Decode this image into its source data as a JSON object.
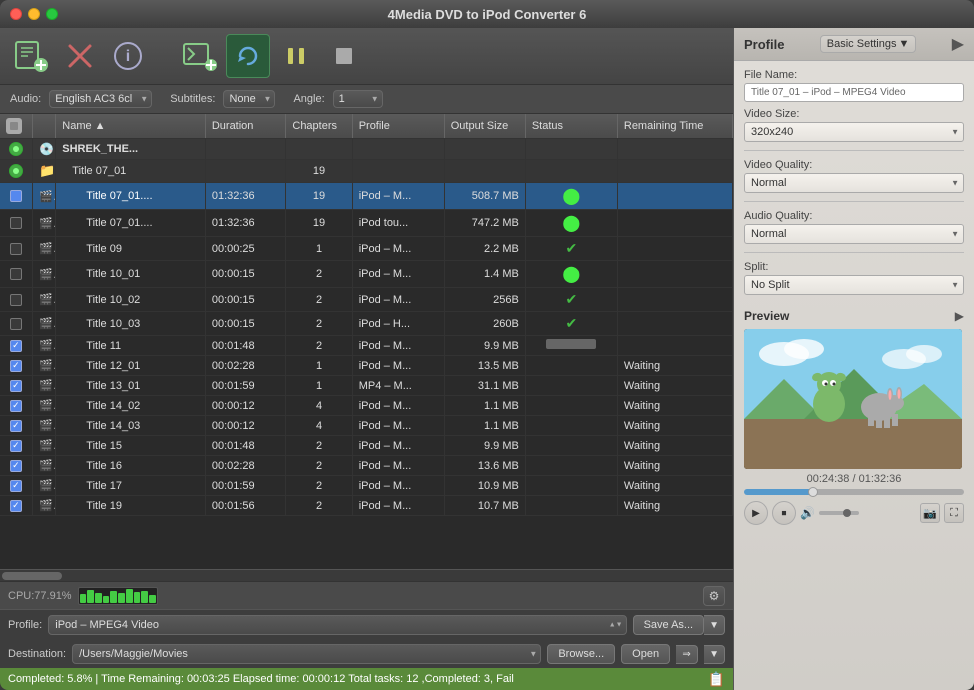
{
  "window": {
    "title": "4Media DVD to iPod Converter 6"
  },
  "toolbar": {
    "buttons": [
      {
        "id": "add",
        "label": "Add",
        "icon": "🎬+"
      },
      {
        "id": "delete",
        "label": "Delete",
        "icon": "✕"
      },
      {
        "id": "info",
        "label": "Info",
        "icon": "ℹ"
      },
      {
        "id": "add2",
        "label": "Add2",
        "icon": "📺+"
      },
      {
        "id": "refresh",
        "label": "Refresh/Convert",
        "icon": "↻"
      },
      {
        "id": "pause",
        "label": "Pause",
        "icon": "⏸"
      },
      {
        "id": "stop",
        "label": "Stop",
        "icon": "⏹"
      }
    ]
  },
  "controls": {
    "audio_label": "Audio:",
    "audio_value": "English AC3 6cl",
    "subtitles_label": "Subtitles:",
    "subtitles_value": "None",
    "angle_label": "Angle:",
    "angle_value": "1"
  },
  "table": {
    "headers": [
      "",
      "",
      "Name",
      "Duration",
      "Chapters",
      "Profile",
      "Output Size",
      "Status",
      "Remaining Time"
    ],
    "rows": [
      {
        "level": 0,
        "checked": null,
        "icon": "disc",
        "name": "SHREK_THE...",
        "duration": "",
        "chapters": "",
        "profile": "",
        "size": "",
        "status": "",
        "remaining": "",
        "row_type": "disc"
      },
      {
        "level": 1,
        "checked": null,
        "icon": "folder",
        "name": "Title 07_01",
        "duration": "",
        "chapters": "19",
        "profile": "",
        "size": "",
        "status": "",
        "remaining": "",
        "row_type": "folder"
      },
      {
        "level": 2,
        "checked": true,
        "icon": "movie",
        "name": "Title 07_01....",
        "duration": "01:32:36",
        "chapters": "19",
        "profile": "iPod – M...",
        "size": "508.7 MB",
        "status": "green_circle",
        "remaining": "",
        "row_type": "item",
        "selected": true
      },
      {
        "level": 2,
        "checked": false,
        "icon": "movie",
        "name": "Title 07_01....",
        "duration": "01:32:36",
        "chapters": "19",
        "profile": "iPod tou...",
        "size": "747.2 MB",
        "status": "green_circle",
        "remaining": "",
        "row_type": "item"
      },
      {
        "level": 2,
        "checked": false,
        "icon": "movie",
        "name": "Title 09",
        "duration": "00:00:25",
        "chapters": "1",
        "profile": "iPod – M...",
        "size": "2.2 MB",
        "status": "check_green",
        "remaining": "",
        "row_type": "item"
      },
      {
        "level": 2,
        "checked": false,
        "icon": "movie",
        "name": "Title 10_01",
        "duration": "00:00:15",
        "chapters": "2",
        "profile": "iPod – M...",
        "size": "1.4 MB",
        "status": "green_circle",
        "remaining": "",
        "row_type": "item"
      },
      {
        "level": 2,
        "checked": false,
        "icon": "movie",
        "name": "Title 10_02",
        "duration": "00:00:15",
        "chapters": "2",
        "profile": "iPod – M...",
        "size": "256B",
        "status": "check_green",
        "remaining": "",
        "row_type": "item"
      },
      {
        "level": 2,
        "checked": false,
        "icon": "movie",
        "name": "Title 10_03",
        "duration": "00:00:15",
        "chapters": "2",
        "profile": "iPod – H...",
        "size": "260B",
        "status": "check_green",
        "remaining": "",
        "row_type": "item"
      },
      {
        "level": 2,
        "checked": true,
        "icon": "movie",
        "name": "Title 11",
        "duration": "00:01:48",
        "chapters": "2",
        "profile": "iPod – M...",
        "size": "9.9 MB",
        "status": "progress",
        "remaining": "",
        "row_type": "item"
      },
      {
        "level": 2,
        "checked": true,
        "icon": "movie",
        "name": "Title 12_01",
        "duration": "00:02:28",
        "chapters": "1",
        "profile": "iPod – M...",
        "size": "13.5 MB",
        "status": "text",
        "remaining": "Waiting",
        "row_type": "item"
      },
      {
        "level": 2,
        "checked": true,
        "icon": "movie",
        "name": "Title 13_01",
        "duration": "00:01:59",
        "chapters": "1",
        "profile": "MP4 – M...",
        "size": "31.1 MB",
        "status": "text",
        "remaining": "Waiting",
        "row_type": "item"
      },
      {
        "level": 2,
        "checked": true,
        "icon": "movie",
        "name": "Title 14_02",
        "duration": "00:00:12",
        "chapters": "4",
        "profile": "iPod – M...",
        "size": "1.1 MB",
        "status": "text",
        "remaining": "Waiting",
        "row_type": "item"
      },
      {
        "level": 2,
        "checked": true,
        "icon": "movie",
        "name": "Title 14_03",
        "duration": "00:00:12",
        "chapters": "4",
        "profile": "iPod – M...",
        "size": "1.1 MB",
        "status": "text",
        "remaining": "Waiting",
        "row_type": "item"
      },
      {
        "level": 2,
        "checked": true,
        "icon": "movie",
        "name": "Title 15",
        "duration": "00:01:48",
        "chapters": "2",
        "profile": "iPod – M...",
        "size": "9.9 MB",
        "status": "text",
        "remaining": "Waiting",
        "row_type": "item"
      },
      {
        "level": 2,
        "checked": true,
        "icon": "movie",
        "name": "Title 16",
        "duration": "00:02:28",
        "chapters": "2",
        "profile": "iPod – M...",
        "size": "13.6 MB",
        "status": "text",
        "remaining": "Waiting",
        "row_type": "item"
      },
      {
        "level": 2,
        "checked": true,
        "icon": "movie",
        "name": "Title 17",
        "duration": "00:01:59",
        "chapters": "2",
        "profile": "iPod – M...",
        "size": "10.9 MB",
        "status": "text",
        "remaining": "Waiting",
        "row_type": "item"
      },
      {
        "level": 2,
        "checked": true,
        "icon": "movie",
        "name": "Title 19",
        "duration": "00:01:56",
        "chapters": "2",
        "profile": "iPod – M...",
        "size": "10.7 MB",
        "status": "text",
        "remaining": "Waiting",
        "row_type": "item"
      }
    ]
  },
  "cpu": {
    "label": "CPU:77.91%"
  },
  "profile_bar": {
    "label": "Profile:",
    "value": "iPod – MPEG4 Video",
    "save_as": "Save As..."
  },
  "destination_bar": {
    "label": "Destination:",
    "value": "/Users/Maggie/Movies",
    "browse_label": "Browse...",
    "open_label": "Open"
  },
  "status_bar": {
    "text": "Completed: 5.8% | Time Remaining: 00:03:25 Elapsed time: 00:00:12 Total tasks: 12 ,Completed: 3, Fail"
  },
  "right_panel": {
    "profile_label": "Profile",
    "settings_label": "Basic Settings",
    "file_name_label": "File Name:",
    "file_name_value": "Title 07_01 – iPod – MPEG4 Video",
    "video_size_label": "Video Size:",
    "video_size_value": "320x240",
    "video_quality_label": "Video Quality:",
    "video_quality_value": "Normal",
    "audio_quality_label": "Audio Quality:",
    "audio_quality_value": "Normal",
    "split_label": "Split:",
    "split_value": "No Split",
    "preview_label": "Preview",
    "time_current": "00:24:38",
    "time_total": "01:32:36"
  }
}
